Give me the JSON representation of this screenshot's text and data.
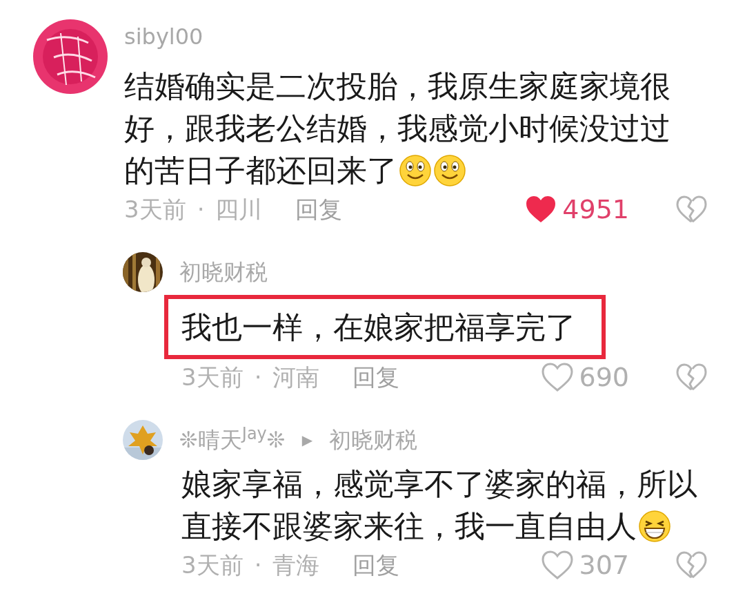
{
  "comments": [
    {
      "user": "sibyl00",
      "text_lines": [
        "结婚确实是二次投胎，我原生家庭家境很",
        "好，跟我老公结婚，我感觉小时候没过过",
        "的苦日子都还回来了"
      ],
      "emojis": [
        {
          "kind": "smile"
        },
        {
          "kind": "smile"
        }
      ],
      "time": "3天前",
      "separator": "·",
      "location": "四川",
      "reply": "回复",
      "likes": "4951",
      "liked": true,
      "highlighted": false,
      "replies": [
        {
          "user": "初晓财税",
          "text_lines": [
            "我也一样，在娘家把福享完了"
          ],
          "time": "3天前",
          "separator": "·",
          "location": "河南",
          "reply": "回复",
          "likes": "690",
          "liked": false,
          "highlighted": true
        },
        {
          "user": "❊晴天$^{Jay}$❊",
          "reply_arrow": "▶",
          "reply_to": "初晓财税",
          "text_lines": [
            "娘家享福，感觉享不了婆家的福，所以",
            "直接不跟婆家来往，我一直自由人"
          ],
          "emojis": [
            {
              "kind": "grin"
            }
          ],
          "time": "3天前",
          "separator": "·",
          "location": "青海",
          "reply": "回复",
          "likes": "307",
          "liked": false,
          "highlighted": false
        }
      ]
    }
  ]
}
